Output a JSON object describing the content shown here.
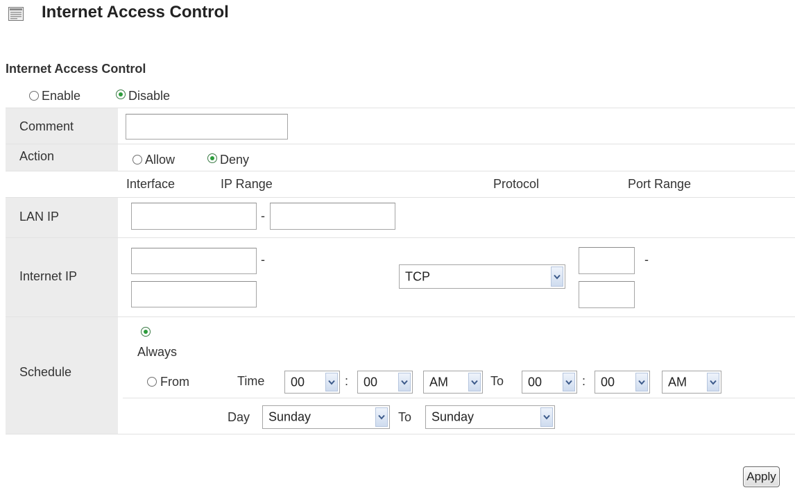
{
  "page_title": "Internet Access Control",
  "section_title": "Internet Access Control",
  "access": {
    "enable_label": "Enable",
    "disable_label": "Disable",
    "selected": "Disable"
  },
  "comment": {
    "label": "Comment",
    "value": ""
  },
  "action": {
    "label": "Action",
    "allow_label": "Allow",
    "deny_label": "Deny",
    "selected": "Deny"
  },
  "columns": {
    "interface": "Interface",
    "ip_range": "IP Range",
    "protocol": "Protocol",
    "port_range": "Port Range"
  },
  "lan_ip": {
    "label": "LAN IP",
    "start": "",
    "end": "",
    "separator": "-"
  },
  "internet_ip": {
    "label": "Internet IP",
    "start": "",
    "end": "",
    "separator": "-",
    "protocol": "TCP",
    "port_start": "",
    "port_end": "",
    "port_separator": "-"
  },
  "schedule": {
    "label": "Schedule",
    "always_label": "Always",
    "from_label": "From",
    "selected": "Always",
    "time_label": "Time",
    "from_hour": "00",
    "from_minute": "00",
    "from_ampm": "AM",
    "to_label": "To",
    "to_hour": "00",
    "to_minute": "00",
    "to_ampm": "AM",
    "colon": ":",
    "day_label": "Day",
    "from_day": "Sunday",
    "day_to_label": "To",
    "to_day": "Sunday"
  },
  "apply_label": "Apply",
  "icons": {
    "title": "page-icon",
    "dropdown": "chevron-down-icon"
  }
}
